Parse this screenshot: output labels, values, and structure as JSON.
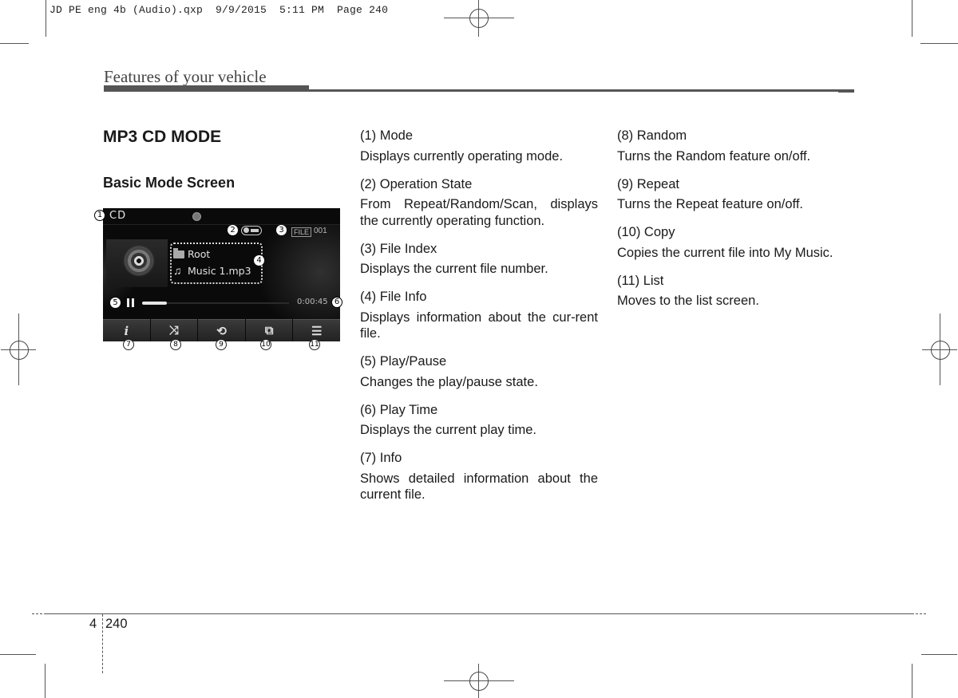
{
  "slug": "JD PE eng 4b (Audio).qxp  9/9/2015  5:11 PM  Page 240",
  "section_title": "Features of your vehicle",
  "heading": "MP3 CD MODE",
  "subheading": "Basic Mode Screen",
  "screen": {
    "mode": "CD",
    "file_tag": "FILE",
    "file_index": "001",
    "folder": "Root",
    "track": "Music 1.mp3",
    "play_time": "0:00:45",
    "progress_fraction": 0.17,
    "icons": {
      "folder": "folder-icon",
      "note": "music-note-icon",
      "pause": "pause-icon",
      "disc": "cd-disc-icon",
      "operation_state": "repeat-one-icon"
    },
    "buttons": [
      {
        "name": "info",
        "glyph": "i",
        "icon": "info-icon",
        "callout": "7"
      },
      {
        "name": "random",
        "glyph": "⤨",
        "icon": "shuffle-icon",
        "callout": "8"
      },
      {
        "name": "repeat",
        "glyph": "⟲",
        "icon": "repeat-icon",
        "callout": "9"
      },
      {
        "name": "copy",
        "glyph": "⧉",
        "icon": "copy-icon",
        "callout": "10"
      },
      {
        "name": "list",
        "glyph": "☰",
        "icon": "list-icon",
        "callout": "11"
      }
    ],
    "callouts": {
      "c1": "1",
      "c2": "2",
      "c3": "3",
      "c4": "4",
      "c5": "5",
      "c6": "6"
    }
  },
  "descriptions": {
    "col1": [
      {
        "label": "(1) Mode",
        "desc": "Displays currently operating mode."
      },
      {
        "label": "(2) Operation State",
        "desc": "From Repeat/Random/Scan, displays the currently operating function."
      },
      {
        "label": "(3) File Index",
        "desc": "Displays the current file number."
      },
      {
        "label": "(4) File Info",
        "desc": "Displays information about the cur-rent file."
      },
      {
        "label": "(5) Play/Pause",
        "desc": "Changes the play/pause state."
      },
      {
        "label": "(6) Play Time",
        "desc": "Displays the current play time."
      },
      {
        "label": "(7) Info",
        "desc": "Shows detailed information about the current file."
      }
    ],
    "col2": [
      {
        "label": "(8) Random",
        "desc": "Turns the Random feature on/off."
      },
      {
        "label": "(9) Repeat",
        "desc": "Turns the Repeat feature on/off."
      },
      {
        "label": "(10) Copy",
        "desc": "Copies the current file into My Music."
      },
      {
        "label": "(11) List",
        "desc": "Moves to the list screen."
      }
    ]
  },
  "footer": {
    "chapter": "4",
    "page": "240"
  }
}
